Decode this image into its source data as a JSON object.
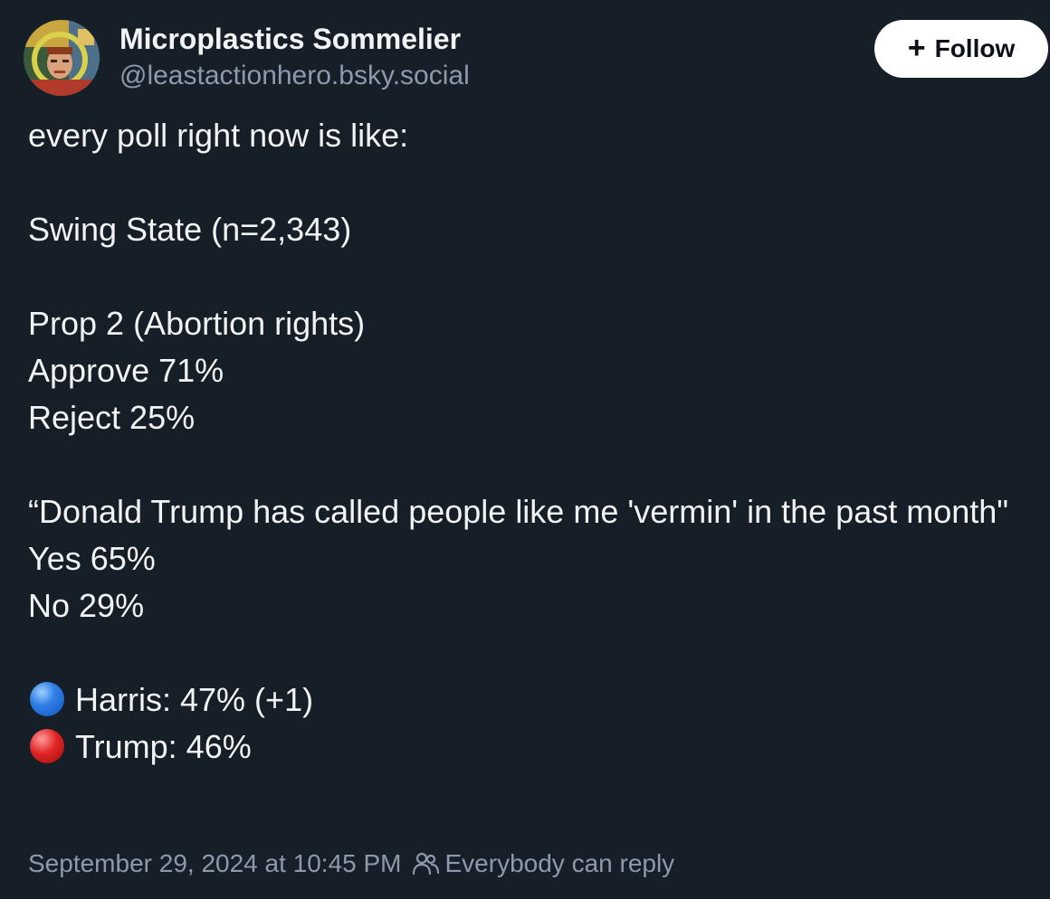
{
  "author": {
    "display_name": "Microplastics Sommelier",
    "handle": "@leastactionhero.bsky.social"
  },
  "follow_button": {
    "label": "Follow",
    "icon": "plus-icon"
  },
  "post": {
    "intro": "every poll right now is like:",
    "poll_title": "Swing State (n=2,343)",
    "question_1": "Prop 2 (Abortion rights)",
    "q1_answer_1": "Approve 71%",
    "q1_answer_2": "Reject 25%",
    "question_2": "“Donald Trump has called people like me 'vermin' in the past month\"",
    "q2_answer_1": "Yes 65%",
    "q2_answer_2": "No 29%",
    "candidate_1": "Harris: 47% (+1)",
    "candidate_2": "Trump: 46%"
  },
  "footer": {
    "timestamp": "September 29, 2024 at 10:45 PM",
    "reply_setting": "Everybody can reply",
    "reply_icon": "people-icon"
  },
  "colors": {
    "background": "#161e27",
    "text": "#f1f3f5",
    "muted": "#8d9aab",
    "follow_bg": "#ffffff"
  }
}
